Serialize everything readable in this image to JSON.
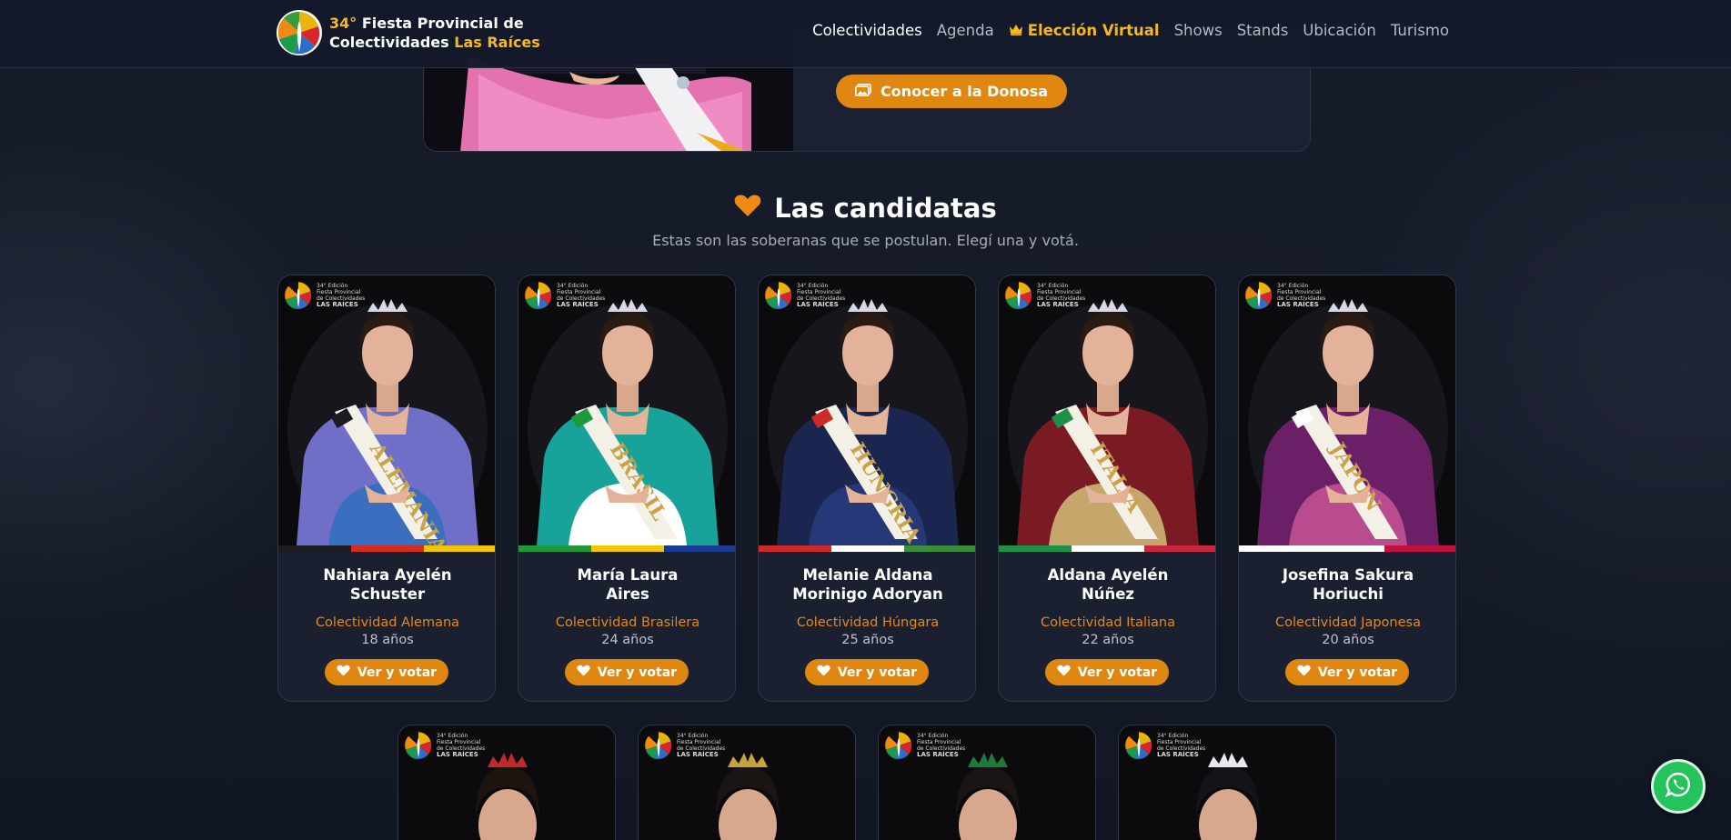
{
  "header": {
    "brand_line1_prefix": "34°",
    "brand_line1": " Fiesta Provincial de",
    "brand_line2": "Colectividades ",
    "brand_line2_highlight": "Las Raíces",
    "nav": [
      {
        "label": "Colectividades",
        "active": true
      },
      {
        "label": "Agenda"
      },
      {
        "label": "Elección Virtual",
        "icon": "crown-icon",
        "highlight": true
      },
      {
        "label": "Shows"
      },
      {
        "label": "Stands"
      },
      {
        "label": "Ubicación"
      },
      {
        "label": "Turismo"
      }
    ]
  },
  "featured": {
    "button_label": "Conocer a la Donosa",
    "button_icon": "images-icon"
  },
  "section": {
    "title": "Las candidatas",
    "title_icon": "heart-icon",
    "subtitle": "Estas son las soberanas que se postulan. Elegí una y votá."
  },
  "badge": {
    "edition": "34° Edición",
    "line1": "Fiesta Provincial",
    "line2": "de Colectividades",
    "line3": "LAS RAÍCES"
  },
  "candidates": [
    {
      "name_l1": "Nahiara Ayelén",
      "name_l2": "Schuster",
      "colectividad": "Colectividad Alemana",
      "age": "18 años",
      "sash": "ALEMANIA",
      "flag": [
        "#1b1d22",
        "#d42b1e",
        "#f2c500"
      ],
      "dress": "#6f6fc8",
      "skirt": "#3a6fc0"
    },
    {
      "name_l1": "María Laura",
      "name_l2": "Aires",
      "colectividad": "Colectividad Brasilera",
      "age": "24 años",
      "sash": "BRASIL",
      "flag": [
        "#1d9a3d",
        "#f3c600",
        "#1b3a93"
      ],
      "dress": "#18a39a",
      "skirt": "#ffffff"
    },
    {
      "name_l1": "Melanie Aldana",
      "name_l2": "Morinigo Adoryan",
      "colectividad": "Colectividad Húngara",
      "age": "25 años",
      "sash": "HUNGRIA",
      "flag": [
        "#cf2a2a",
        "#ffffff",
        "#3a8d3a"
      ],
      "dress": "#1a2550",
      "skirt": "#253878"
    },
    {
      "name_l1": "Aldana Ayelén",
      "name_l2": "Núñez",
      "colectividad": "Colectividad Italiana",
      "age": "22 años",
      "sash": "ITALIA",
      "flag": [
        "#1d9246",
        "#ffffff",
        "#c9263d"
      ],
      "dress": "#7a1a22",
      "skirt": "#c6a66a"
    },
    {
      "name_l1": "Josefina Sakura",
      "name_l2": "Horiuchi",
      "colectividad": "Colectividad Japonesa",
      "age": "20 años",
      "sash": "JAPON",
      "flag": [
        "#ffffff",
        "#ffffff",
        "#c0123c"
      ],
      "dress": "#6a1f66",
      "skirt": "#b84c8e"
    }
  ],
  "vote_label": "Ver y votar",
  "vote_icon": "heart-icon",
  "whatsapp_icon": "whatsapp-icon"
}
